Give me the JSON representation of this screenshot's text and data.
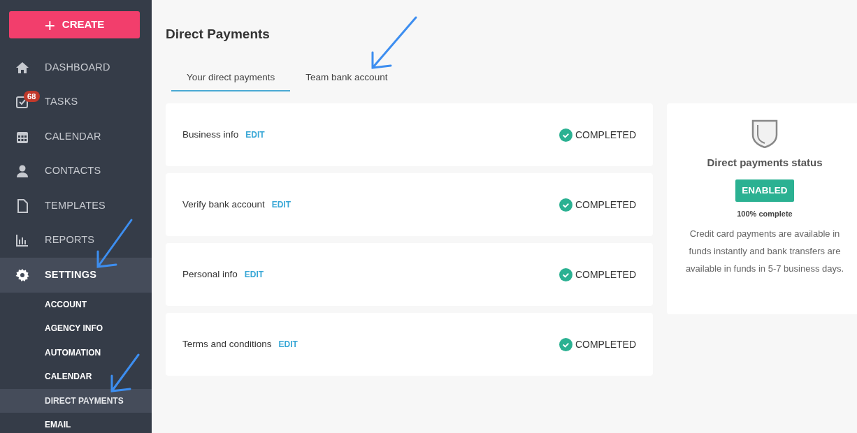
{
  "sidebar": {
    "create_button": {
      "icon": "+",
      "label": "CREATE"
    },
    "items": [
      {
        "label": "DASHBOARD",
        "selected": false
      },
      {
        "label": "TASKS",
        "selected": false,
        "badge": "68"
      },
      {
        "label": "CALENDAR",
        "selected": false
      },
      {
        "label": "CONTACTS",
        "selected": false
      },
      {
        "label": "TEMPLATES",
        "selected": false
      },
      {
        "label": "REPORTS",
        "selected": false
      },
      {
        "label": "SETTINGS",
        "selected": true,
        "expanded": true,
        "children": [
          {
            "label": "ACCOUNT",
            "selected": false
          },
          {
            "label": "AGENCY INFO",
            "selected": false
          },
          {
            "label": "AUTOMATION",
            "selected": false
          },
          {
            "label": "CALENDAR",
            "selected": false
          },
          {
            "label": "DIRECT PAYMENTS",
            "selected": true
          },
          {
            "label": "EMAIL",
            "selected": false
          }
        ]
      }
    ]
  },
  "page": {
    "title": "Direct Payments",
    "tabs": [
      {
        "label": "Your direct payments",
        "selected": true
      },
      {
        "label": "Team bank account",
        "selected": false
      }
    ],
    "steps": [
      {
        "label": "Business info",
        "action": "EDIT",
        "status": "COMPLETED",
        "completed": true
      },
      {
        "label": "Verify bank account",
        "action": "EDIT",
        "status": "COMPLETED",
        "completed": true
      },
      {
        "label": "Personal info",
        "action": "EDIT",
        "status": "COMPLETED",
        "completed": true
      },
      {
        "label": "Terms and conditions",
        "action": "EDIT",
        "status": "COMPLETED",
        "completed": true
      }
    ],
    "status_card": {
      "title": "Direct payments status",
      "badge": "ENABLED",
      "progress": "100% complete",
      "description": "Credit card payments are available in funds instantly and bank transfers are available in funds in 5-7 business days."
    }
  }
}
